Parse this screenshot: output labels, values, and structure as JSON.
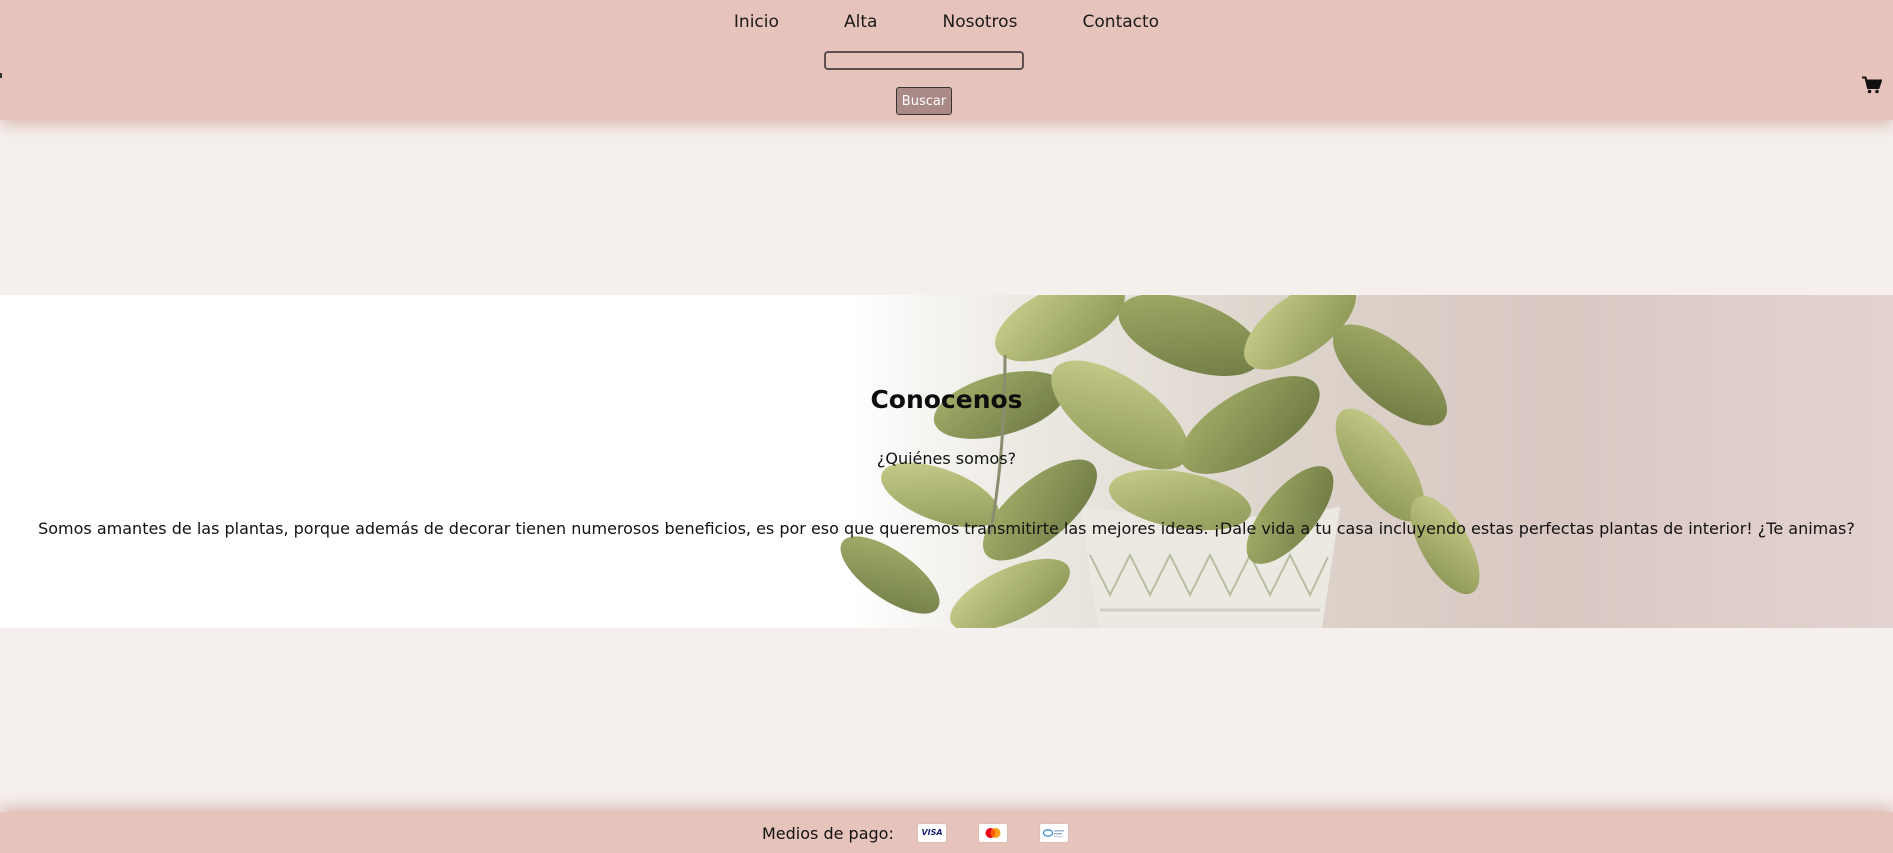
{
  "nav": {
    "items": [
      {
        "label": "Inicio"
      },
      {
        "label": "Alta"
      },
      {
        "label": "Nosotros"
      },
      {
        "label": "Contacto"
      }
    ]
  },
  "search": {
    "value": "",
    "placeholder": "",
    "button_label": "Buscar"
  },
  "cart": {
    "icon": "cart-icon"
  },
  "hero": {
    "title": "Conocenos",
    "subtitle": "¿Quiénes somos?",
    "text": "Somos amantes de las plantas, porque además de decorar tienen numerosos beneficios, es por eso que queremos transmitirte las mejores ideas. ¡Dale vida a tu casa incluyendo estas perfectas plantas de interior! ¿Te animas?"
  },
  "footer": {
    "payment_label": "Medios de pago:",
    "cards": [
      {
        "name": "visa-icon",
        "text": "VISA"
      },
      {
        "name": "mastercard-icon"
      },
      {
        "name": "mercadopago-icon"
      }
    ]
  },
  "colors": {
    "header_bg": "#e6c4bc",
    "page_bg": "#f5f0ed",
    "button_bg": "#a98a86"
  }
}
